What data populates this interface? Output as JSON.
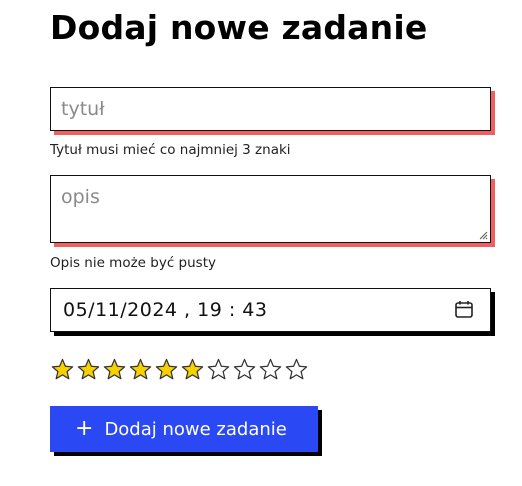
{
  "page": {
    "heading": "Dodaj nowe zadanie"
  },
  "form": {
    "title_field": {
      "placeholder": "tytuł",
      "value": ""
    },
    "title_hint": "Tytuł musi mieć co najmniej 3 znaki",
    "description_field": {
      "placeholder": "opis",
      "value": ""
    },
    "description_hint": "Opis nie może być pusty",
    "datetime_field": {
      "value": "05/11/2024 , 19 : 43",
      "icon": "calendar-icon"
    },
    "rating": {
      "value": 6,
      "max": 10,
      "filled_color": "#f7d000",
      "outline_color": "#333333"
    },
    "submit": {
      "label": "Dodaj nowe zadanie",
      "icon": "plus-icon",
      "color": "#2a48f4"
    }
  },
  "colors": {
    "error_shadow": "#ef6060",
    "default_shadow": "#000000"
  }
}
